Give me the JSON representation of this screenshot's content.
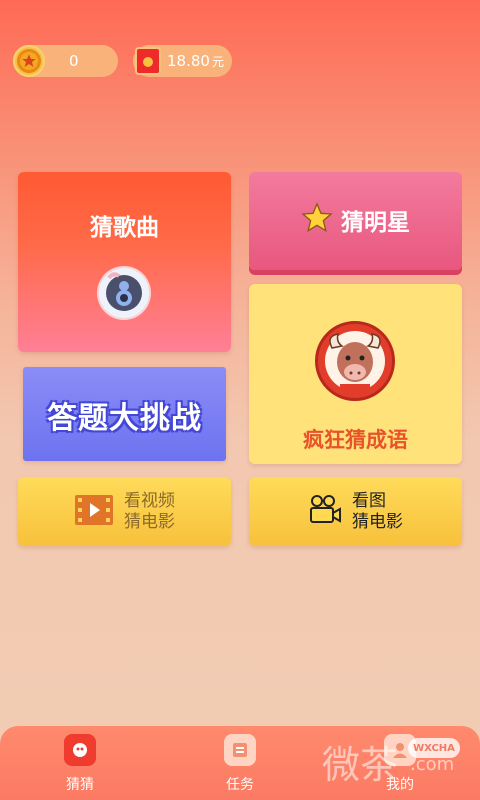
{
  "header": {
    "coins": "0",
    "cash": "18.80",
    "cash_unit": "元"
  },
  "cards": {
    "guess_song": "猜歌曲",
    "guess_star": "猜明星",
    "crazy_idiom": "疯狂猜成语",
    "quiz_challenge": "答题大挑战",
    "video_movie_line1": "看视频",
    "video_movie_line2": "猜电影",
    "picture_movie_line1": "看图",
    "picture_movie_line2": "猜电影"
  },
  "tabbar": {
    "items": [
      {
        "label": "猜猜",
        "icon": "guess-icon"
      },
      {
        "label": "任务",
        "icon": "task-icon"
      },
      {
        "label": "我的",
        "icon": "profile-icon"
      }
    ]
  },
  "watermark": {
    "text": "微茶",
    "badge": "WXCHA",
    "domain": ".com"
  },
  "colors": {
    "song_card": "#ff5a33",
    "star_card": "#e9577e",
    "idiom_card": "#ffe27a",
    "quiz_card": "#6d73f0",
    "movie_cards": "#f7c13b",
    "tabbar": "#fb7a63"
  }
}
